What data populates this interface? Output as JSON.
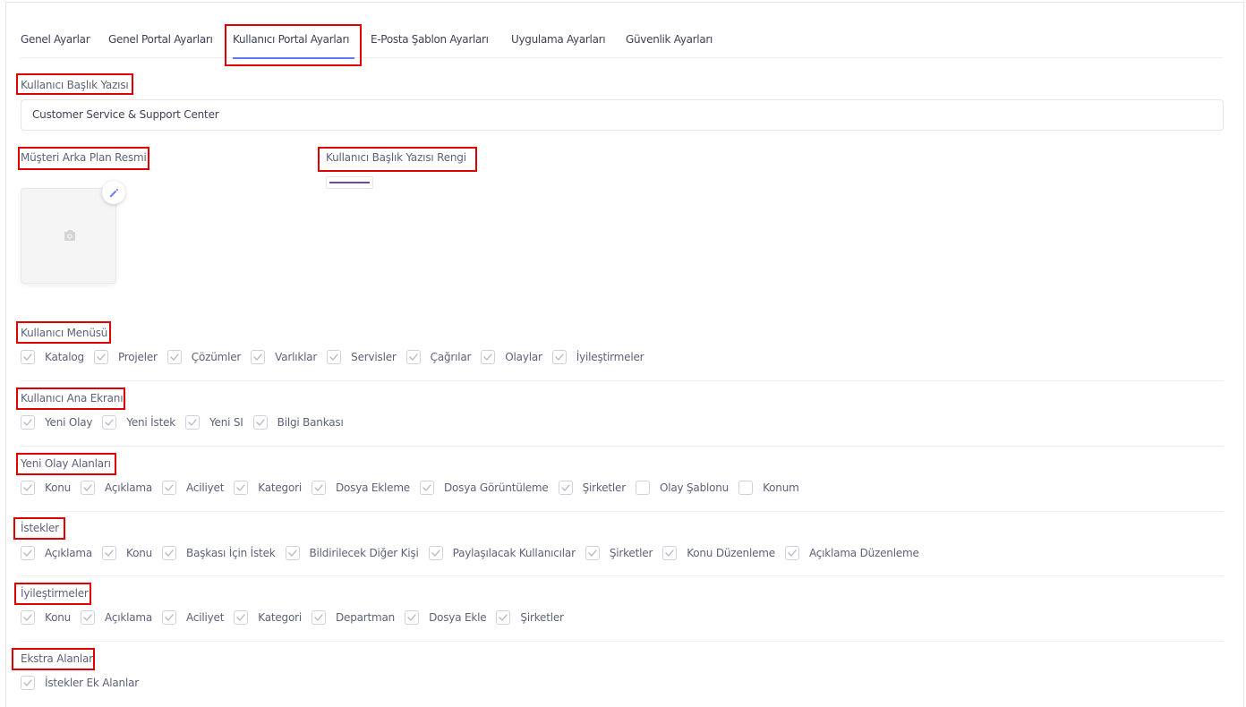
{
  "tabs": [
    {
      "label": "Genel Ayarlar",
      "active": false
    },
    {
      "label": "Genel Portal Ayarları",
      "active": false
    },
    {
      "label": "Kullanıcı Portal Ayarları",
      "active": true
    },
    {
      "label": "E-Posta Şablon Ayarları",
      "active": false
    },
    {
      "label": "Uygulama Ayarları",
      "active": false
    },
    {
      "label": "Güvenlik Ayarları",
      "active": false
    }
  ],
  "header_text": {
    "label": "Kullanıcı Başlık Yazısı",
    "value": "Customer Service & Support Center"
  },
  "background_image": {
    "label": "Müşteri Arka Plan Resmi",
    "placeholder_icon": "camera-icon",
    "edit_icon": "pencil-icon"
  },
  "header_color": {
    "label": "Kullanıcı Başlık Yazısı Rengi",
    "value": "#6c4a9e"
  },
  "sections": [
    {
      "title": "Kullanıcı Menüsü",
      "items": [
        {
          "label": "Katalog",
          "checked": true
        },
        {
          "label": "Projeler",
          "checked": true
        },
        {
          "label": "Çözümler",
          "checked": true
        },
        {
          "label": "Varlıklar",
          "checked": true
        },
        {
          "label": "Servisler",
          "checked": true
        },
        {
          "label": "Çağrılar",
          "checked": true
        },
        {
          "label": "Olaylar",
          "checked": true
        },
        {
          "label": "İyileştirmeler",
          "checked": true
        }
      ]
    },
    {
      "title": "Kullanıcı Ana Ekranı",
      "items": [
        {
          "label": "Yeni Olay",
          "checked": true
        },
        {
          "label": "Yeni İstek",
          "checked": true
        },
        {
          "label": "Yeni SI",
          "checked": true
        },
        {
          "label": "Bilgi Bankası",
          "checked": true
        }
      ]
    },
    {
      "title": "Yeni Olay Alanları",
      "items": [
        {
          "label": "Konu",
          "checked": true
        },
        {
          "label": "Açıklama",
          "checked": true
        },
        {
          "label": "Aciliyet",
          "checked": true
        },
        {
          "label": "Kategori",
          "checked": true
        },
        {
          "label": "Dosya Ekleme",
          "checked": true
        },
        {
          "label": "Dosya Görüntüleme",
          "checked": true
        },
        {
          "label": "Şirketler",
          "checked": true
        },
        {
          "label": "Olay Şablonu",
          "checked": false
        },
        {
          "label": "Konum",
          "checked": false
        }
      ]
    },
    {
      "title": "İstekler",
      "items": [
        {
          "label": "Açıklama",
          "checked": true
        },
        {
          "label": "Konu",
          "checked": true
        },
        {
          "label": "Başkası İçin İstek",
          "checked": true
        },
        {
          "label": "Bildirilecek Diğer Kişi",
          "checked": true
        },
        {
          "label": "Paylaşılacak Kullanıcılar",
          "checked": true
        },
        {
          "label": "Şirketler",
          "checked": true
        },
        {
          "label": "Konu Düzenleme",
          "checked": true
        },
        {
          "label": "Açıklama Düzenleme",
          "checked": true
        }
      ]
    },
    {
      "title": "İyileştirmeler",
      "items": [
        {
          "label": "Konu",
          "checked": true
        },
        {
          "label": "Açıklama",
          "checked": true
        },
        {
          "label": "Aciliyet",
          "checked": true
        },
        {
          "label": "Kategori",
          "checked": true
        },
        {
          "label": "Departman",
          "checked": true
        },
        {
          "label": "Dosya Ekle",
          "checked": true
        },
        {
          "label": "Şirketler",
          "checked": true
        }
      ]
    },
    {
      "title": "Ekstra Alanlar",
      "items": [
        {
          "label": "İstekler Ek Alanlar",
          "checked": true
        }
      ]
    }
  ],
  "colors": {
    "highlight_box": "#e00000",
    "tab_underline": "#5d78ff",
    "checkmark": "#b5b5c3"
  }
}
